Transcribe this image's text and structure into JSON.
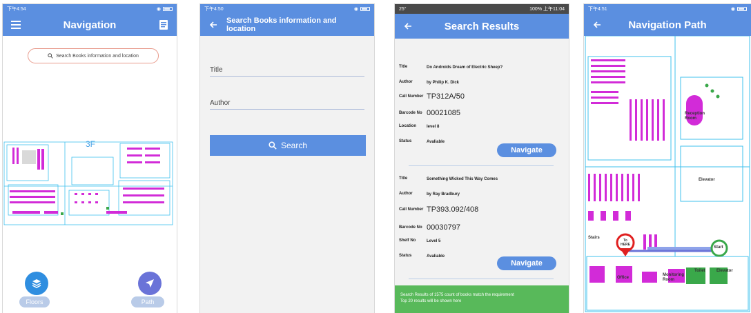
{
  "screens": {
    "navigation": {
      "status_time": "下午4:54",
      "title": "Navigation",
      "search_placeholder": "Search Books information and location",
      "floor": "3F",
      "floors_label": "Floors",
      "path_label": "Path"
    },
    "search": {
      "status_time": "下午4:50",
      "title": "Search Books information and location",
      "title_field": "Title",
      "author_field": "Author",
      "search_button": "Search"
    },
    "results": {
      "status_left": "25°",
      "status_right": "100% 上午11:04",
      "title": "Search Results",
      "labels": {
        "title": "Title",
        "author": "Author",
        "call_number": "Call Number",
        "barcode": "Barcode No",
        "location": "Location",
        "shelf": "Shelf No",
        "status": "Status"
      },
      "items": [
        {
          "title": "Do Androids Dream of Electric Sheep?",
          "author": "by Philip K. Dick",
          "call_number": "TP312A/50",
          "barcode": "00021085",
          "place": "level 8",
          "status": "Avaliable",
          "navigate": "Navigate"
        },
        {
          "title": "Something Wicked This Way Comes",
          "author": "by Ray Bradbury",
          "call_number": "TP393.092/408",
          "barcode": "00030797",
          "place": "Level 5",
          "status": "Avaliable",
          "navigate": "Navigate"
        }
      ],
      "footer_line1": "Search Results of 1575 count of books match the requirement",
      "footer_line2": "Top 20 results will be shown here"
    },
    "path": {
      "status_time": "下午4:51",
      "title": "Navigation Path",
      "reception": "Reception Room",
      "elevator": "Elevator",
      "stairs": "Stairs",
      "to_here": "To HERE",
      "start": "Start",
      "office": "Office",
      "toilet": "Toilet",
      "monitoring": "Monitoring Room",
      "elevator2": "Elevator"
    }
  },
  "colors": {
    "primary": "#5b8fe0",
    "fab": "#2f8ee0",
    "fab_path": "#6a73d8",
    "green": "#58b95a",
    "map_magenta": "#d22bd8",
    "map_cyan": "#3fc0ee",
    "destination": "#e02020",
    "start": "#3aa84a"
  }
}
